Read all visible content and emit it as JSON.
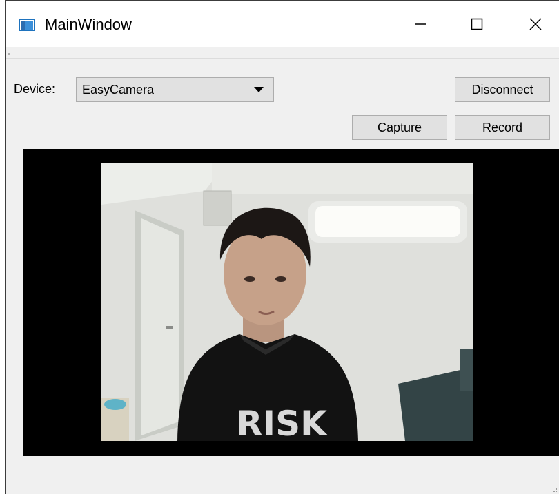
{
  "window": {
    "title": "MainWindow",
    "icon": "window-app-icon",
    "controls": {
      "minimize": "minimize-icon",
      "maximize": "maximize-icon",
      "close": "close-icon"
    }
  },
  "toolbar": {
    "device_label": "Device:",
    "device_selected": "EasyCamera",
    "disconnect_label": "Disconnect",
    "capture_label": "Capture",
    "record_label": "Record"
  },
  "viewer": {
    "content": "camera-feed",
    "overlay_text": "RISK"
  },
  "colors": {
    "window_bg": "#f0f0f0",
    "button_bg": "#e1e1e1",
    "viewport_bg": "#000000"
  }
}
